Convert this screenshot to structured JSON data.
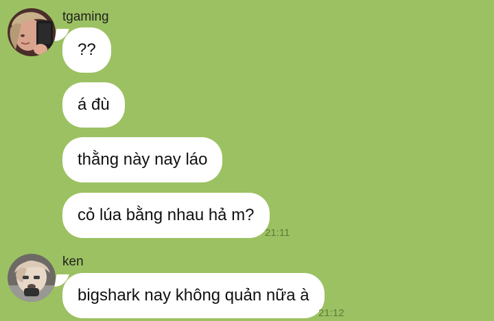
{
  "conversation": {
    "group1": {
      "sender": "tgaming",
      "avatar": "avatar-tgaming",
      "messages": [
        {
          "text": "??"
        },
        {
          "text": "á đù"
        },
        {
          "text": "thằng này nay láo"
        },
        {
          "text": "cỏ lúa bằng nhau hả m?",
          "time": "21:11"
        }
      ]
    },
    "group2": {
      "sender": "ken",
      "avatar": "avatar-ken",
      "messages": [
        {
          "text": "bigshark nay không quản nữa à",
          "time": "21:12"
        }
      ]
    }
  },
  "colors": {
    "background": "#9cc162",
    "bubble": "#ffffff",
    "timestamp": "#5e7b39"
  }
}
